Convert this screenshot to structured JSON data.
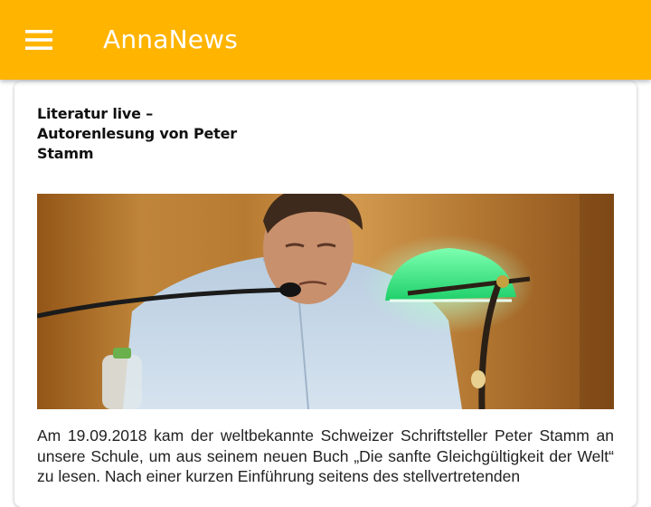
{
  "appbar": {
    "title": "AnnaNews",
    "menu_icon": "hamburger-menu-icon",
    "background": "#ffb400",
    "title_color": "#ffffff"
  },
  "article": {
    "title": "Literatur live – Autorenlesung von Peter Stamm",
    "image_subject": "photo-of-author-reading-at-desk",
    "body": "Am 19.09.2018 kam der weltbekannte Schweizer Schriftsteller Peter Stamm an unsere Schule, um aus seinem neuen Buch „Die sanfte Gleichgültigkeit der Welt“ zu lesen. Nach einer kurzen Einführung seitens des stellvertretenden"
  }
}
